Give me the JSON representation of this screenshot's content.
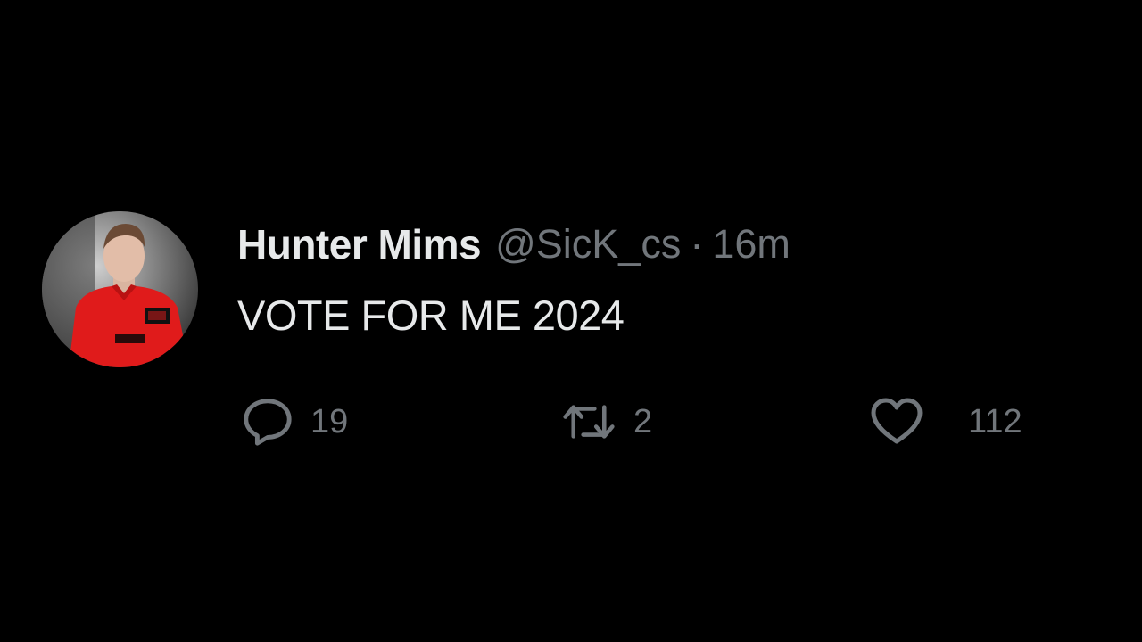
{
  "tweet": {
    "author": {
      "display_name": "Hunter Mims",
      "handle": "@SicK_cs",
      "avatar_icon": "profile-photo"
    },
    "separator": "·",
    "timestamp": "16m",
    "text": "VOTE FOR ME 2024",
    "actions": {
      "reply": {
        "icon": "reply-icon",
        "count": "19"
      },
      "retweet": {
        "icon": "retweet-icon",
        "count": "2"
      },
      "like": {
        "icon": "heart-icon",
        "count": "112"
      }
    }
  },
  "colors": {
    "background": "#000000",
    "primary_text": "#e7e9ea",
    "secondary_text": "#71767b",
    "avatar_shirt": "#e01b1b"
  }
}
